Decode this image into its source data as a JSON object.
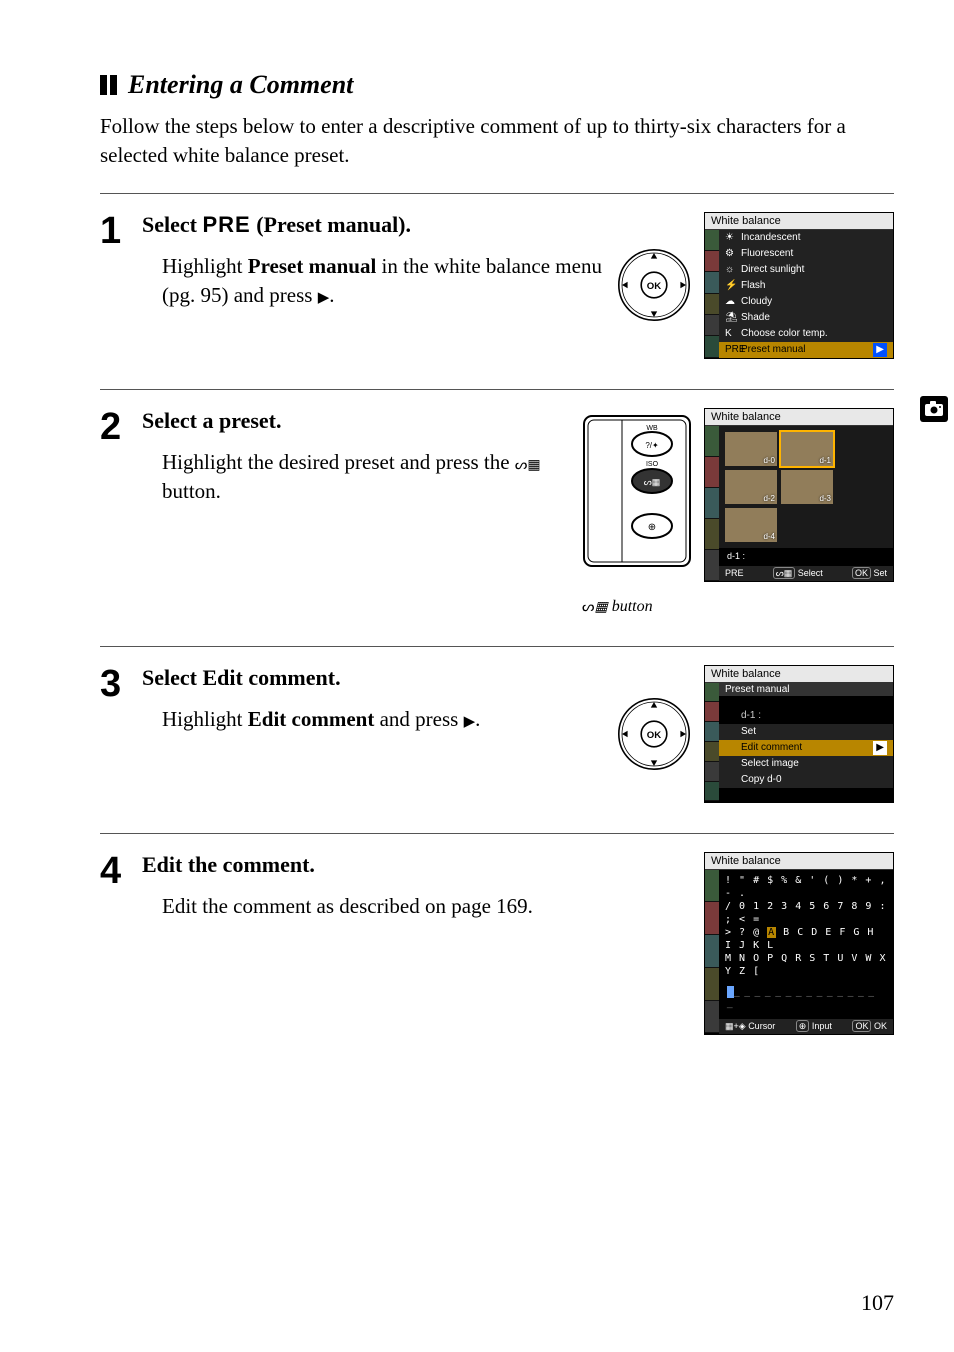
{
  "section_title": "Entering a Comment",
  "intro": "Follow the steps below to enter a descriptive comment of up to thirty-six characters for a selected white balance preset.",
  "steps": [
    {
      "num": "1",
      "head_pre": "Select ",
      "head_code": "PRE",
      "head_post": " (Preset manual).",
      "text_pre": "Highlight ",
      "text_bold": "Preset manual",
      "text_post": " in the white balance menu (pg. 95) and press ",
      "text_tail": "."
    },
    {
      "num": "2",
      "head": "Select a preset.",
      "text_pre": "Highlight the desired preset and press the ",
      "text_post": " button."
    },
    {
      "num": "3",
      "head_pre": "Select ",
      "head_bold": "Edit comment",
      "head_post": ".",
      "text_pre": "Highlight ",
      "text_bold": "Edit comment",
      "text_post": " and press ",
      "text_tail": "."
    },
    {
      "num": "4",
      "head": "Edit the comment.",
      "text": "Edit the comment as described on page 169."
    }
  ],
  "lcd1": {
    "title": "White balance",
    "items": [
      "Incandescent",
      "Fluorescent",
      "Direct sunlight",
      "Flash",
      "Cloudy",
      "Shade",
      "Choose color temp.",
      "Preset manual"
    ],
    "icons": [
      "☀",
      "⚙",
      "☼",
      "⚡",
      "☁",
      "⛱",
      "K",
      "PRE"
    ]
  },
  "lcd2": {
    "title": "White balance",
    "thumbs": [
      "d-0",
      "d-1",
      "d-2",
      "d-3",
      "d-4"
    ],
    "info": "d-1   :",
    "foot_left": "PRE",
    "foot_mid": "Select",
    "foot_right": "Set"
  },
  "caption2": " button",
  "lcd3": {
    "title": "White balance",
    "sub": "Preset manual",
    "info": "d-1    :",
    "items": [
      "Set",
      "Edit comment",
      "Select image",
      "Copy d-0"
    ]
  },
  "lcd4": {
    "title": "White balance",
    "kb": [
      "  ! \" # $ % & ' ( ) * + , - .",
      "/ 0 1 2 3 4 5 6 7 8 9 : ; < =",
      "> ? @ A B C D E F G H I J K L",
      "M N O P Q R S T U V W X Y Z ["
    ],
    "foot_left": "Cursor",
    "foot_mid": "Input",
    "foot_right": "OK"
  },
  "page_number": "107",
  "glyphs": {
    "right_triangle": "▶",
    "ok": "OK",
    "q_minus": "⊖",
    "q_grid": "▦"
  }
}
